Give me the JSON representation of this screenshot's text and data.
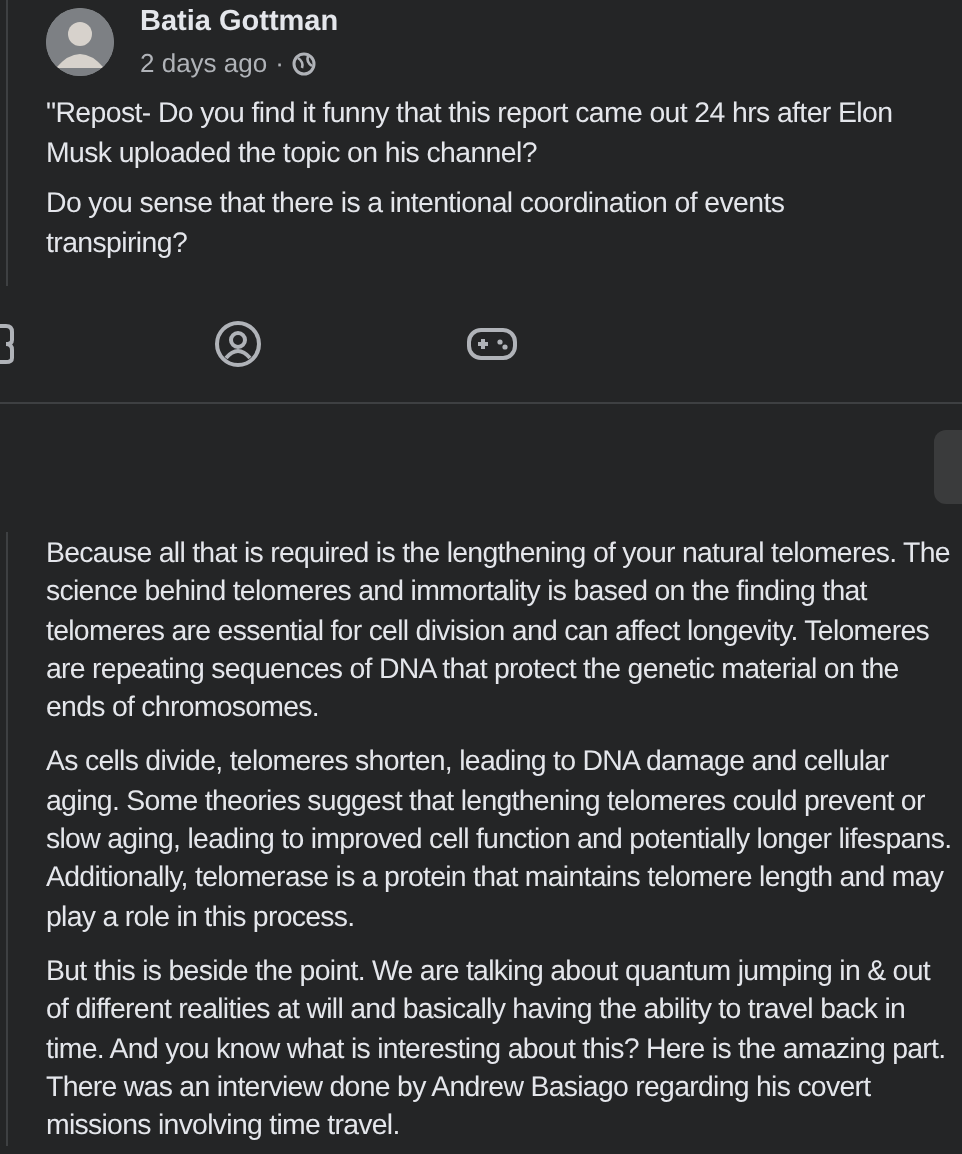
{
  "post": {
    "author": "Batia Gottman",
    "time": "2 days ago",
    "separator": "·",
    "paragraphs": [
      "\"Repost- Do you find it funny that this report came out 24 hrs  after Elon Musk uploaded the topic on his channel?",
      "Do you sense that there is a intentional coordination of events transpiring?"
    ]
  },
  "message": {
    "paragraphs": [
      "Because all that is required is the lengthening of your natural telomeres. The science behind telomeres and immortality is based on the finding that telomeres are essential for cell division and can affect longevity. Telomeres are repeating sequences of DNA that protect the genetic material on the ends of chromosomes.",
      "As cells divide, telomeres shorten, leading to DNA damage and cellular aging. Some theories suggest that lengthening telomeres could prevent or slow aging, leading to improved cell function and potentially longer lifespans. Additionally, telomerase is a protein that maintains telomere length and may play a role in this process.",
      "But this is beside the point. We are talking about quantum jumping in & out of different realities at will and basically having the ability to travel back in time. And you know what is interesting about this? Here is the amazing part. There was an interview done by Andrew Basiago regarding his covert missions involving time travel."
    ]
  }
}
